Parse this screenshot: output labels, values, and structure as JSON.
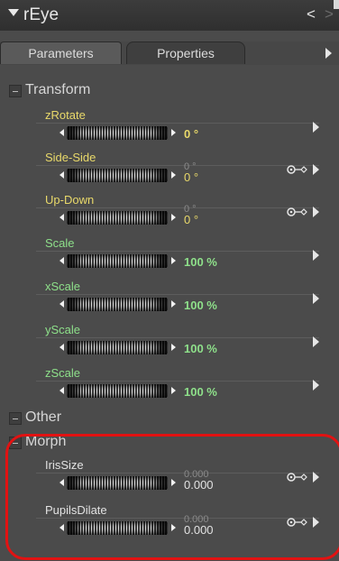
{
  "window": {
    "title": "rEye",
    "prev_glyph": "<",
    "next_glyph": ">"
  },
  "tabs": {
    "parameters": "Parameters",
    "properties": "Properties"
  },
  "groups": {
    "transform": "Transform",
    "other": "Other",
    "morph": "Morph"
  },
  "params": [
    {
      "name": "zRotate",
      "value": "0 °"
    },
    {
      "name": "Side-Side",
      "min": "0 °",
      "value": "0 °"
    },
    {
      "name": "Up-Down",
      "min": "0 °",
      "value": "0 °"
    },
    {
      "name": "Scale",
      "value": "100 %"
    },
    {
      "name": "xScale",
      "value": "100 %"
    },
    {
      "name": "yScale",
      "value": "100 %"
    },
    {
      "name": "zScale",
      "value": "100 %"
    },
    {
      "name": "IrisSize",
      "min": "0.000",
      "value": "0.000"
    },
    {
      "name": "PupilsDilate",
      "min": "0.000",
      "value": "0.000"
    }
  ],
  "icons": {
    "title_arrow": "triangle-down",
    "tab_arrow": "triangle-right",
    "row_arrow": "triangle-right",
    "key_icon": "key"
  },
  "colors": {
    "label_yellow": "#e9d96a",
    "value_green": "#8ee08a",
    "highlight_red": "#e21212"
  }
}
